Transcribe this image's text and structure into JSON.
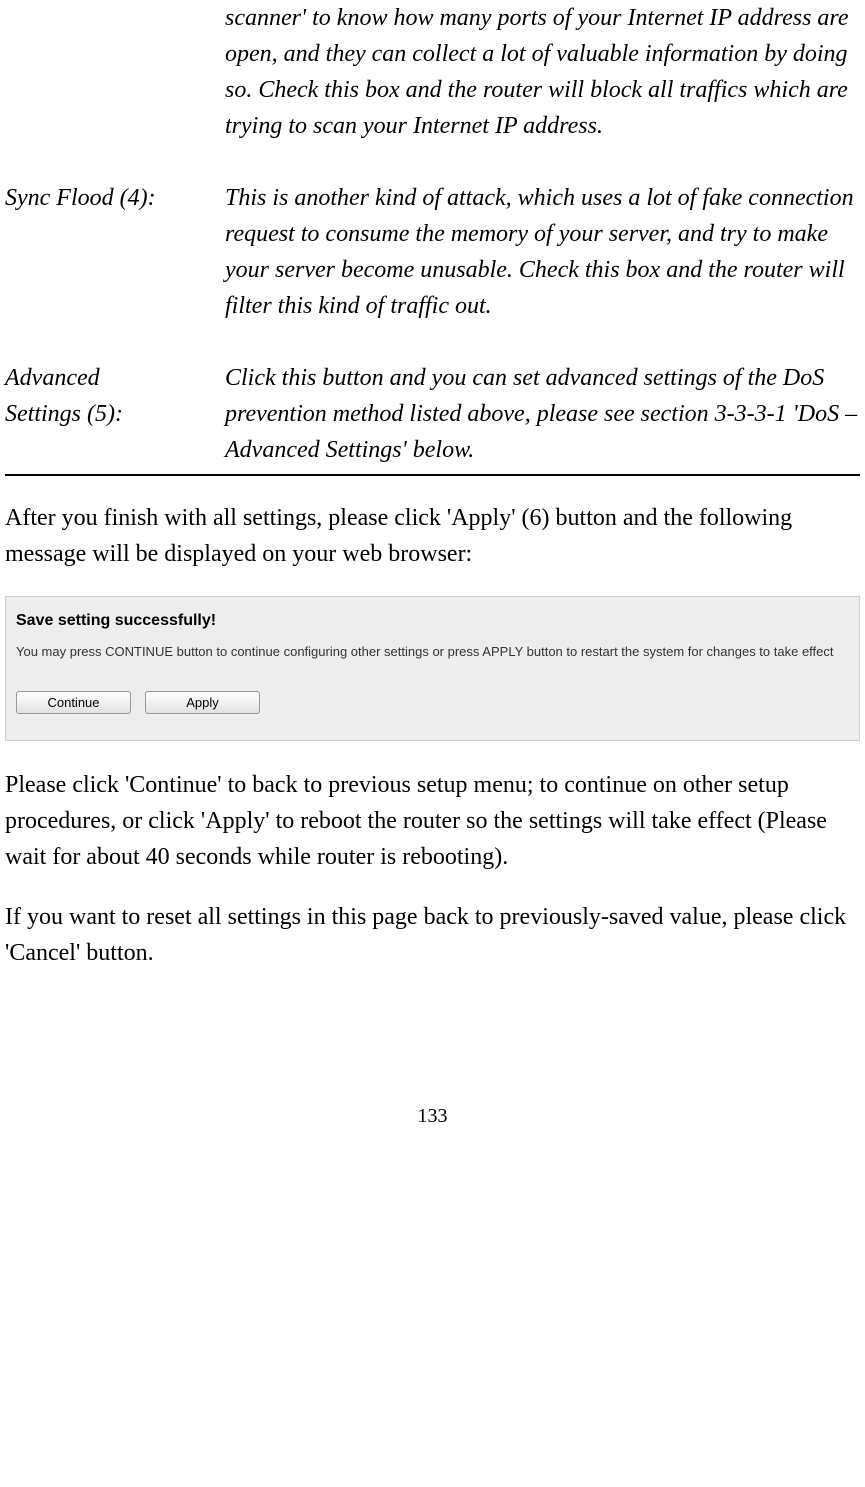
{
  "definitions": {
    "portscan_fragment": "scanner' to know how many ports of your Internet IP address are open, and they can collect a lot of valuable information by doing so. Check this box and the router will block all traffics which are trying to scan your Internet IP address.",
    "sync_flood": {
      "term": "Sync Flood (4):",
      "desc": "This is another kind of attack, which uses a lot of fake connection request to consume the memory of your server, and try to make your server become unusable. Check this box and the router will filter this kind of traffic out."
    },
    "advanced_settings": {
      "term_line1": "Advanced",
      "term_line2": "Settings (5):",
      "desc": "Click this button and you can set advanced settings of the DoS prevention method listed above, please see section 3-3-3-1 'DoS – Advanced Settings' below."
    }
  },
  "paragraphs": {
    "after_settings": "After you finish with all settings, please click 'Apply' (6) button and the following message will be displayed on your web browser:",
    "continue_apply": "Please click 'Continue' to back to previous setup menu; to continue on other setup procedures, or click 'Apply' to reboot the router so the settings will take effect (Please wait for about 40 seconds while router is rebooting).",
    "cancel_note": "If you want to reset all settings in this page back to previously-saved value, please click 'Cancel' button."
  },
  "dialog": {
    "title": "Save setting successfully!",
    "text": "You may press CONTINUE button to continue configuring other settings or press APPLY button to restart the system for changes to take effect",
    "continue_label": "Continue",
    "apply_label": "Apply"
  },
  "page_number": "133"
}
